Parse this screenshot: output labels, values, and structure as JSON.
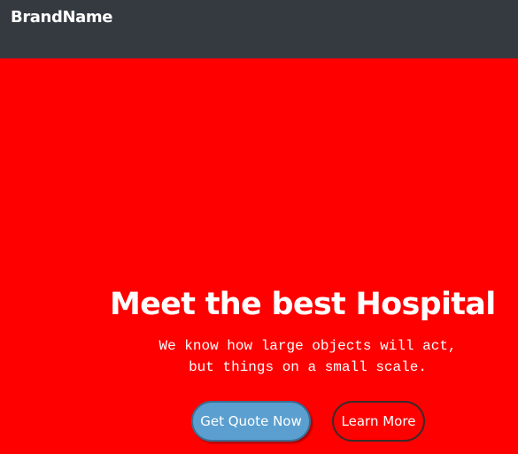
{
  "navbar": {
    "brand": "BrandName"
  },
  "hero": {
    "title": "Meet the best Hospital",
    "text_lines": [
      "We know how large objects will act,",
      "but things on a small scale."
    ],
    "buttons": {
      "primary": "Get Quote Now",
      "secondary": "Learn More"
    }
  },
  "colors": {
    "navbar_bg": "#353a40",
    "hero_bg": "#ff0000",
    "primary_button": "#5b9fd0"
  }
}
